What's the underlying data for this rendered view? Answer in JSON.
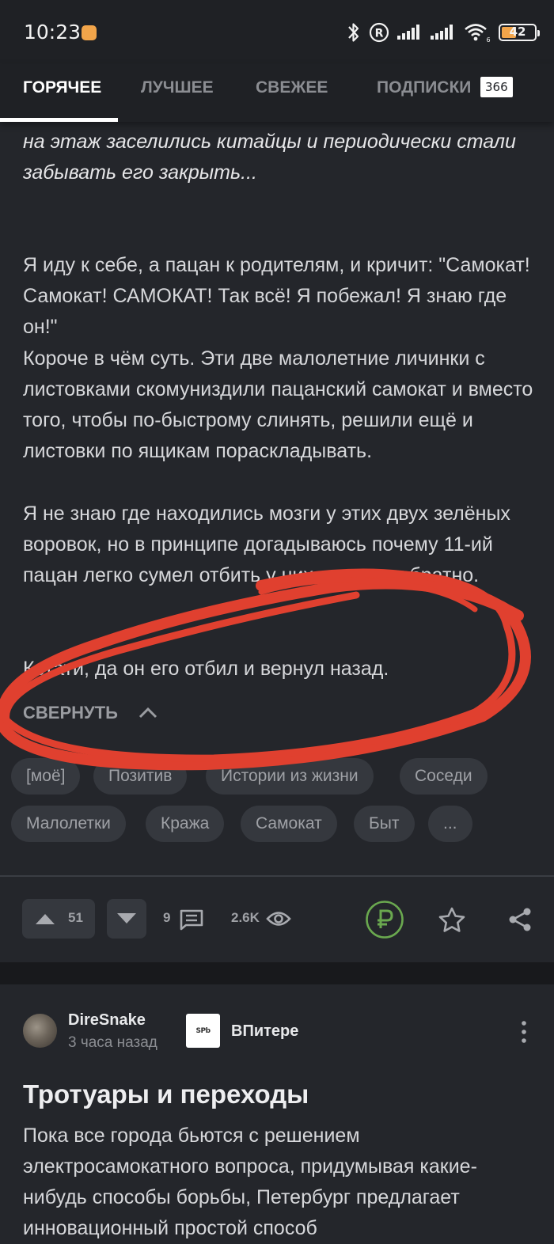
{
  "status_bar": {
    "time": "10:23",
    "battery": "42",
    "network_indicator": "6"
  },
  "tabs": [
    {
      "label": "ГОРЯЧЕЕ",
      "active": true
    },
    {
      "label": "ЛУЧШЕЕ",
      "active": false
    },
    {
      "label": "СВЕЖЕЕ",
      "active": false
    },
    {
      "label": "ПОДПИСКИ",
      "active": false,
      "badge": "366"
    }
  ],
  "post": {
    "paragraphs": [
      "на этаж заселились китайцы и периодически стали забывать его закрыть...",
      "Я иду к себе, а пацан к родителям, и кричит: \"Самокат! Самокат! САМОКАТ! Так всё! Я побежал! Я знаю где он!\"",
      "Короче в чём суть. Эти две малолетние личинки с листовками скомуниздили пацанский самокат и вместо того, чтобы по-быстрому слинять, решили ещё и листовки по ящикам пораскладывать.",
      "Я не знаю где находились мозги у этих двух зелёных воровок, но в принципе догадываюсь почему 11-ий пацан легко сумел отбить у них самокат обратно.",
      "Кстати, да он его отбил и вернул назад."
    ],
    "collapse_label": "СВЕРНУТЬ",
    "tags": [
      "[моё]",
      "Позитив",
      "Истории из жизни",
      "Соседи",
      "Малолетки",
      "Кража",
      "Самокат",
      "Быт",
      "..."
    ],
    "rating": "51",
    "comments": "9",
    "views": "2.6K"
  },
  "next_post": {
    "author": "DireSnake",
    "time": "3 часа назад",
    "community_logo_text": "SPb",
    "community": "ВПитере",
    "title": "Тротуары и переходы",
    "body": "Пока все города бьются с решением электросамокатного вопроса, придумывая какие-нибудь способы борьбы, Петербург предлагает инновационный простой способ"
  },
  "colors": {
    "background": "#24262b",
    "bars": "#1f2125",
    "chip": "#35383e",
    "accent_green": "#6aa84f",
    "annotation_red": "#e0402f",
    "battery_orange": "#f2a54a"
  }
}
